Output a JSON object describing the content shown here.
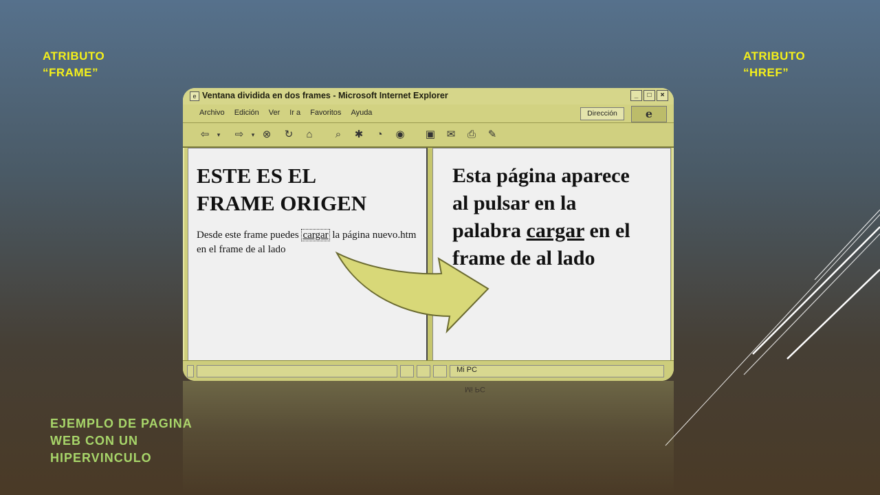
{
  "slide": {
    "label_frame": [
      "ATRIBUTO",
      "“FRAME”"
    ],
    "label_href": [
      "ATRIBUTO",
      "“HREF”"
    ],
    "caption": [
      "EJEMPLO DE PAGINA",
      "WEB CON UN",
      "HIPERVINCULO"
    ]
  },
  "browser": {
    "title": "Ventana dividida en dos frames - Microsoft Internet Explorer",
    "window_buttons": [
      "_",
      "□",
      "×"
    ],
    "menu": [
      "Archivo",
      "Edición",
      "Ver",
      "Ir a",
      "Favoritos",
      "Ayuda"
    ],
    "address_label": "Dirección",
    "logo_glyph": "e",
    "toolbar_icons": [
      "back-icon",
      "forward-icon",
      "stop-icon",
      "refresh-icon",
      "home-icon",
      "search-icon",
      "favorites-icon",
      "history-icon",
      "channels-icon",
      "fullscreen-icon",
      "mail-icon",
      "print-icon",
      "edit-icon"
    ],
    "left_frame": {
      "heading_line1": "ESTE ES EL",
      "heading_line2": "FRAME ORIGEN",
      "text_before": "Desde este frame puedes ",
      "link": "cargar",
      "text_after": " la página nuevo.htm en el frame de al lado"
    },
    "right_frame": {
      "line1": "Esta página aparece",
      "line2": "al pulsar en la",
      "line3_before": "palabra ",
      "line3_link": "cargar",
      "line3_after": " en el",
      "line4": "frame de al lado"
    },
    "status_text": "Mi PC",
    "colors": {
      "chrome": "#cfcf7c",
      "frame_bg": "#f0f0f0",
      "arrow": "#d8d878"
    }
  }
}
